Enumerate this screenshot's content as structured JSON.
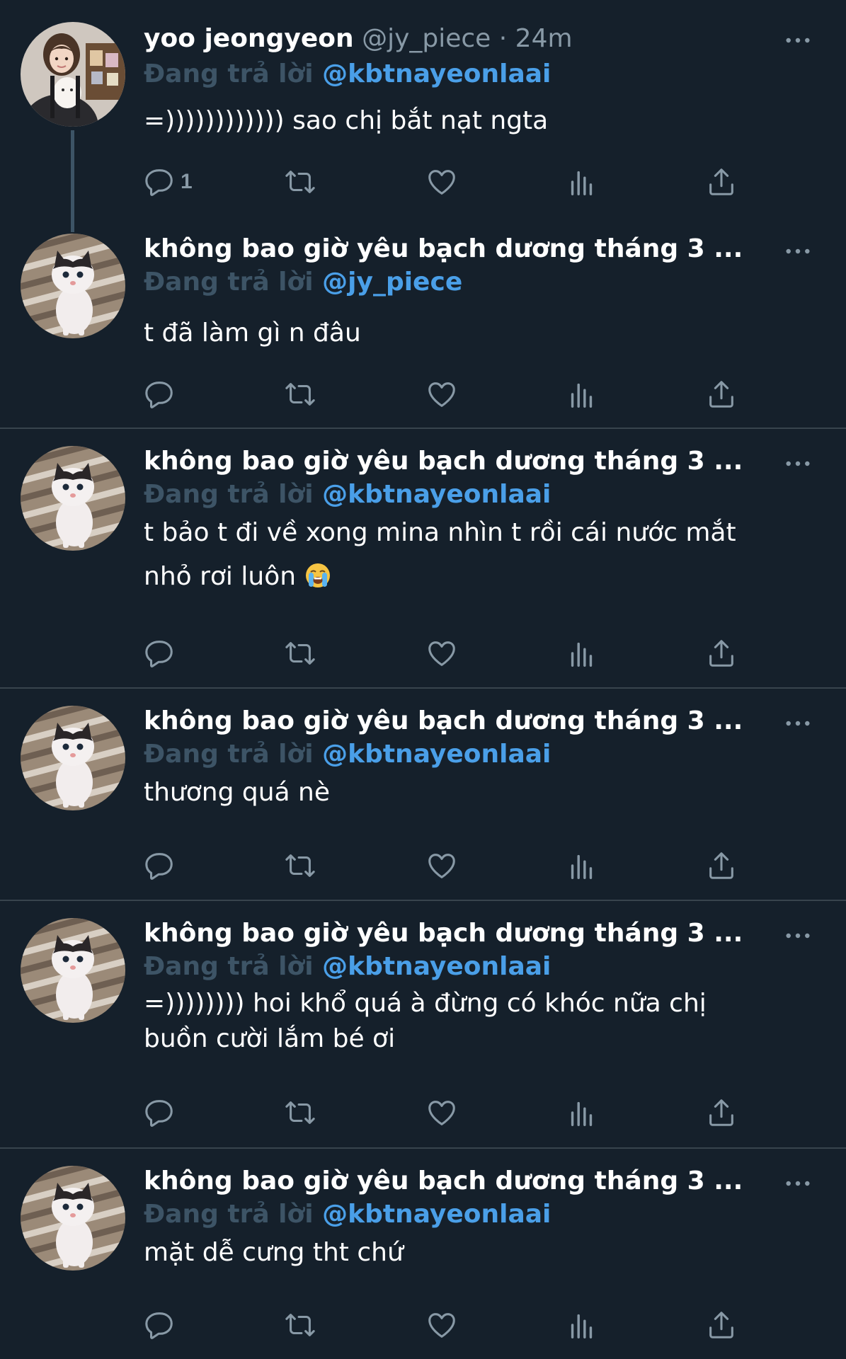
{
  "tweets": [
    {
      "name": "yoo jeongyeon",
      "handle": "@jy_piece",
      "dot": "·",
      "time": "24m",
      "reply_label": "Đang trả lời",
      "reply_to": "@kbtnayeonlaai",
      "text": "=)))))))))))) sao chị bắt nạt ngta",
      "reply_count": "1",
      "avatar": "girl-with-dog"
    },
    {
      "name": "không bao giờ yêu bạch dương tháng 3 ...",
      "reply_label": "Đang trả lời",
      "reply_to": "@jy_piece",
      "text": "t đã làm gì n đâu",
      "avatar": "kitten"
    },
    {
      "name": "không bao giờ yêu bạch dương tháng 3 ...",
      "reply_label": "Đang trả lời",
      "reply_to": "@kbtnayeonlaai",
      "text_line1": "t bảo t đi về xong mina nhìn t rồi cái nước mắt",
      "text_line2": "nhỏ rơi luôn",
      "emoji": "loudly-crying-face",
      "avatar": "kitten"
    },
    {
      "name": "không bao giờ yêu bạch dương tháng 3 ...",
      "reply_label": "Đang trả lời",
      "reply_to": "@kbtnayeonlaai",
      "text": "thương quá nè",
      "avatar": "kitten"
    },
    {
      "name": "không bao giờ yêu bạch dương tháng 3 ...",
      "reply_label": "Đang trả lời",
      "reply_to": "@kbtnayeonlaai",
      "text_line1": "=)))))))) hoi khổ quá à đừng có khóc nữa chị",
      "text_line2": "buồn cười lắm bé ơi",
      "avatar": "kitten"
    },
    {
      "name": "không bao giờ yêu bạch dương tháng 3 ...",
      "reply_label": "Đang trả lời",
      "reply_to": "@kbtnayeonlaai",
      "text": "mặt dễ cưng tht chứ",
      "avatar": "kitten"
    }
  ],
  "icons": {
    "reply": "reply-icon",
    "retweet": "retweet-icon",
    "like": "heart-icon",
    "analytics": "analytics-icon",
    "share": "share-icon",
    "more": "more-icon"
  },
  "colors": {
    "background": "#15202b",
    "divider": "#38444d",
    "secondary_text": "#8899a6",
    "reply_label": "#3d5466",
    "mention": "#4a9fe8",
    "icon": "#8899a6"
  }
}
